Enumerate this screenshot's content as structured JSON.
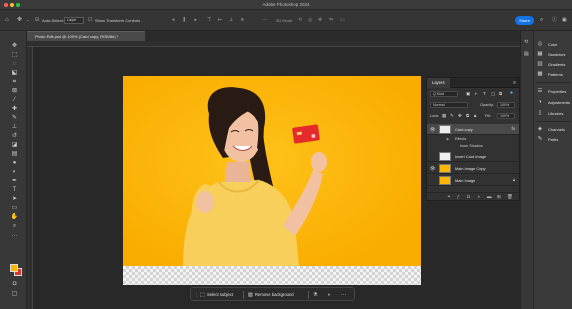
{
  "window": {
    "title": "Adobe Photoshop 2024"
  },
  "options_bar": {
    "auto_select_label": "Auto-Select:",
    "auto_select_value": "Layer",
    "show_transform_label": "Show Transform Controls",
    "mode_label": "3D Mode:",
    "share_label": "Share"
  },
  "document_tab": {
    "label": "Photo Edit.psd @ 100% (Card copy, RGB/8#) *"
  },
  "contextual_taskbar": {
    "select_subject": "Select subject",
    "remove_background": "Remove background",
    "more": "···"
  },
  "layers_panel": {
    "tab_label": "Layers",
    "kind_label": "Q Kind",
    "blend_mode": "Normal",
    "opacity_label": "Opacity:",
    "opacity_value": "100%",
    "lock_label": "Lock:",
    "fill_label": "Fill:",
    "fill_value": "100%",
    "layers": [
      {
        "name": "Card copy",
        "badge": "fx",
        "selected": true
      },
      {
        "name": "Insert Card Image"
      },
      {
        "name": "Main Image Copy"
      },
      {
        "name": "Main Image"
      }
    ],
    "effects_label": "Effects",
    "inner_shadow_label": "Inner Shadow"
  },
  "right_panels": {
    "items": [
      {
        "label": "Color",
        "icon": "color-wheel-icon"
      },
      {
        "label": "Swatches",
        "icon": "swatches-icon"
      },
      {
        "label": "Gradients",
        "icon": "gradients-icon"
      },
      {
        "label": "Patterns",
        "icon": "patterns-icon"
      },
      {
        "label": "Properties",
        "icon": "properties-icon"
      },
      {
        "label": "Adjustments",
        "icon": "adjustments-icon"
      },
      {
        "label": "Libraries",
        "icon": "libraries-icon"
      },
      {
        "label": "Channels",
        "icon": "channels-icon"
      },
      {
        "label": "Paths",
        "icon": "paths-icon"
      }
    ]
  },
  "colors": {
    "canvas_background": "#ffb600",
    "foreground_swatch": "#ffb600",
    "background_swatch": "#d9372b",
    "accent": "#1473e6"
  }
}
